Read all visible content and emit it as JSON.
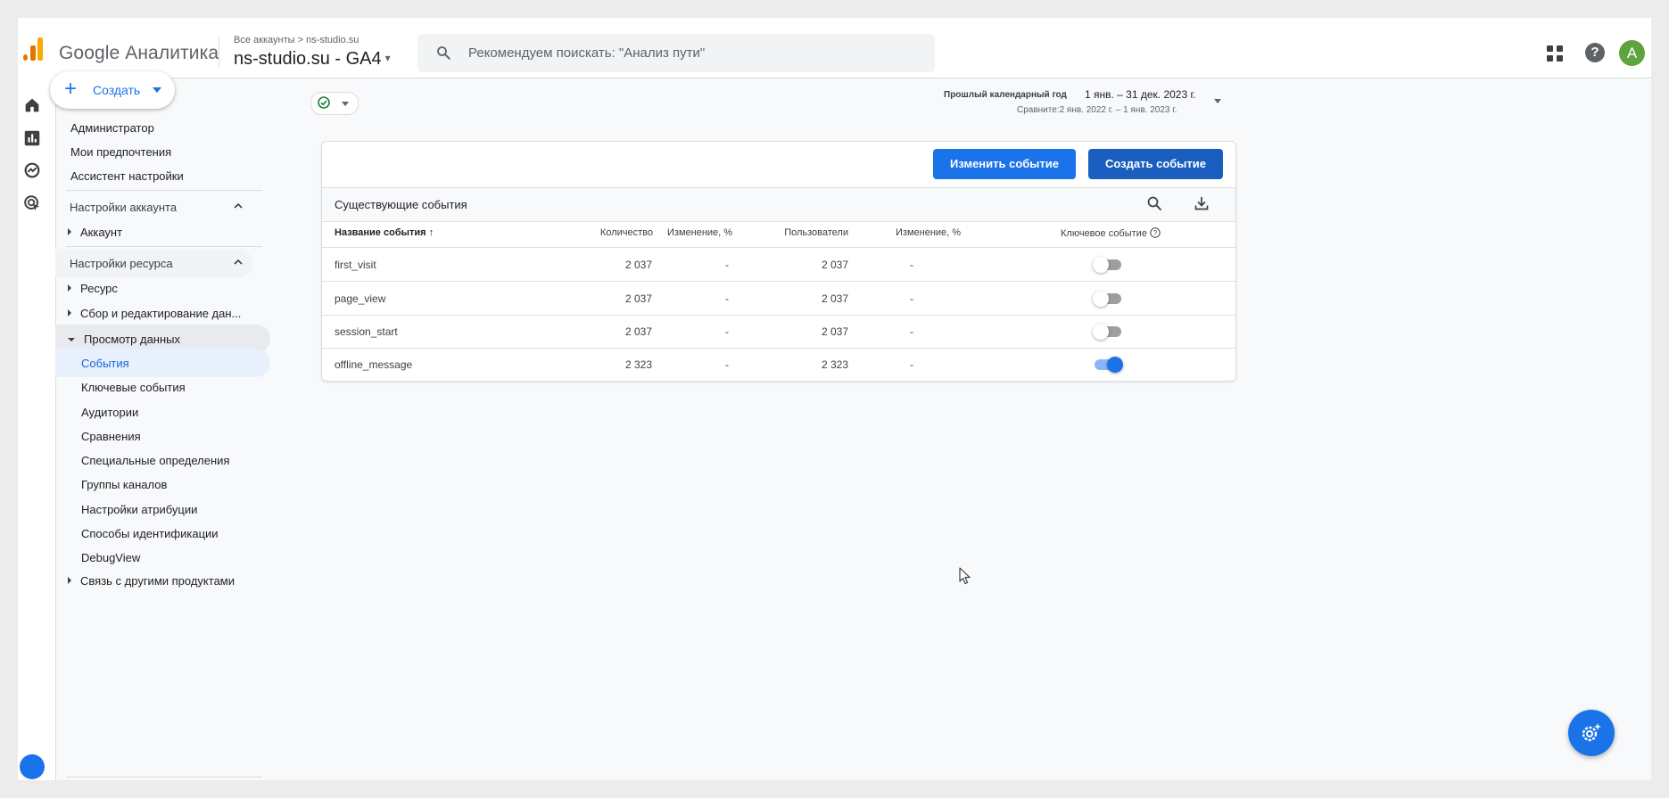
{
  "header": {
    "brand": "Google Аналитика",
    "breadcrumb_all": "Все аккаунты",
    "breadcrumb_sep": ">",
    "breadcrumb_account": "ns-studio.su",
    "property": "ns-studio.su - GA4",
    "property_caret": "▾",
    "search_placeholder": "Рекомендуем поискать: \"Анализ пути\"",
    "help_glyph": "?",
    "avatar_letter": "A",
    "icons": [
      "analytics-logo",
      "search-icon",
      "apps-grid-icon",
      "help-icon"
    ]
  },
  "rail": {
    "icons": [
      "home-icon",
      "reports-icon",
      "explore-icon",
      "advertising-icon"
    ]
  },
  "sidebar": {
    "create_label": "Создать",
    "create_plus": "+",
    "top_links": [
      "Администратор",
      "Мои предпочтения",
      "Ассистент настройки"
    ],
    "account_section": "Настройки аккаунта",
    "account_items": [
      "Аккаунт"
    ],
    "property_section": "Настройки ресурса",
    "property_items": [
      "Ресурс",
      "Сбор и редактирование дан...",
      "Просмотр данных"
    ],
    "data_display_subitems": [
      "События",
      "Ключевые события",
      "Аудитории",
      "Сравнения",
      "Специальные определения",
      "Группы каналов",
      "Настройки атрибуции",
      "Способы идентификации",
      "DebugView"
    ],
    "active_subitem": "События",
    "bottom_item": "Связь с другими продуктами"
  },
  "date": {
    "label": "Прошлый календарный год",
    "range": "1 янв. – 31 дек. 2023 г.",
    "compare": "Сравните:2 янв. 2022 г. – 1 янв. 2023 г."
  },
  "events": {
    "edit_button": "Изменить событие",
    "create_button": "Создать событие",
    "title": "Существующие события",
    "columns": {
      "name": "Название события",
      "sort_arrow": "↑",
      "count": "Количество",
      "count_change": "Изменение, %",
      "users": "Пользователи",
      "users_change": "Изменение, %",
      "key_event": "Ключевое событие"
    },
    "rows": [
      {
        "name": "first_visit",
        "count": "2 037",
        "count_change": "-",
        "users": "2 037",
        "users_change": "-",
        "key": false
      },
      {
        "name": "page_view",
        "count": "2 037",
        "count_change": "-",
        "users": "2 037",
        "users_change": "-",
        "key": false
      },
      {
        "name": "session_start",
        "count": "2 037",
        "count_change": "-",
        "users": "2 037",
        "users_change": "-",
        "key": false
      },
      {
        "name": "offline_message",
        "count": "2 323",
        "count_change": "-",
        "users": "2 323",
        "users_change": "-",
        "key": true
      }
    ]
  },
  "colors": {
    "primary": "#1a73e8",
    "primary_dark": "#1a5fbf",
    "logo_orange": "#f9ab00",
    "logo_dark_orange": "#e37400",
    "avatar": "#5fa33f"
  }
}
